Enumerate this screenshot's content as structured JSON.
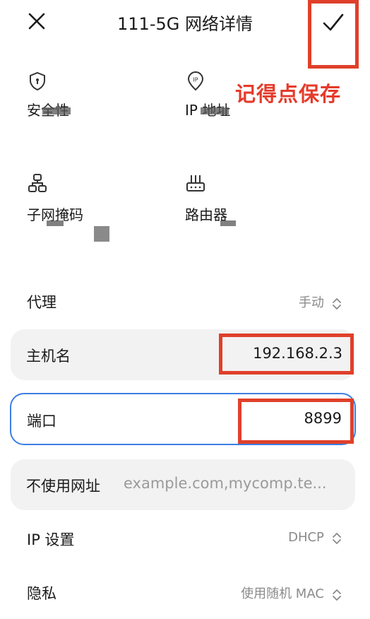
{
  "header": {
    "title": "111-5G 网络详情"
  },
  "annotation": {
    "note": "记得点保存"
  },
  "info_tiles": [
    {
      "label": "安全性",
      "icon": "shield-icon"
    },
    {
      "label": "IP 地址",
      "icon": "ip-icon"
    },
    {
      "label": "子网掩码",
      "icon": "subnet-icon"
    },
    {
      "label": "路由器",
      "icon": "router-icon"
    }
  ],
  "proxy": {
    "label": "代理",
    "value": "手动"
  },
  "hostname": {
    "label": "主机名",
    "value": "192.168.2.3"
  },
  "port": {
    "label": "端口",
    "value": "8899"
  },
  "bypass": {
    "label": "不使用网址",
    "placeholder": "example.com,mycomp.te..."
  },
  "ip_settings": {
    "label": "IP 设置",
    "value": "DHCP"
  },
  "privacy": {
    "label": "隐私",
    "value": "使用随机 MAC"
  },
  "colors": {
    "accent": "#3d7ee4",
    "annotation": "#e0402a"
  }
}
